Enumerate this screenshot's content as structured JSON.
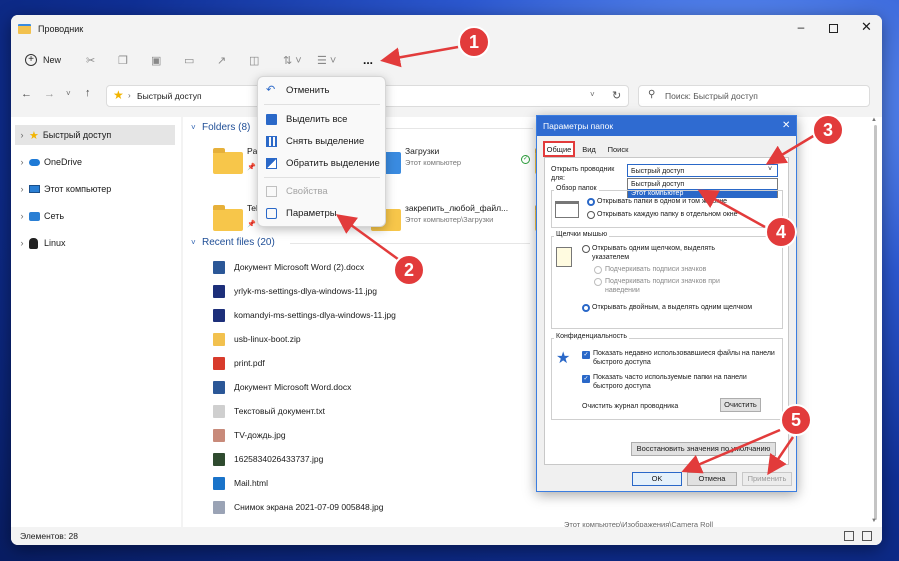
{
  "window": {
    "title": "Проводник"
  },
  "toolbar": {
    "new_label": "New",
    "more_label": "..."
  },
  "address": {
    "path": "Быстрый доступ",
    "search_placeholder": "Поиск: Быстрый доступ"
  },
  "sidebar": {
    "items": [
      {
        "label": "Быстрый доступ",
        "icon": "star-icon"
      },
      {
        "label": "OneDrive",
        "icon": "cloud-icon"
      },
      {
        "label": "Этот компьютер",
        "icon": "computer-icon"
      },
      {
        "label": "Сеть",
        "icon": "network-icon"
      },
      {
        "label": "Linux",
        "icon": "linux-icon"
      }
    ]
  },
  "main": {
    "folders_header": "Folders (8)",
    "folders": [
      {
        "name": "Pa",
        "sub": ""
      },
      {
        "name": "Загрузки",
        "sub": "Этот компьютер"
      },
      {
        "name": "Tel",
        "sub": ""
      },
      {
        "name": "закрепить_любой_файл...",
        "sub": "Этот компьютер\\Загрузки"
      }
    ],
    "recent_header": "Recent files (20)",
    "recent": [
      {
        "name": "Документ Microsoft Word (2).docx",
        "color": "#2b5797"
      },
      {
        "name": "yrlyk-ms-settings-dlya-windows-11.jpg",
        "color": "#1d2f7a"
      },
      {
        "name": "komandyi-ms-settings-dlya-windows-11.jpg",
        "color": "#1d2f7a"
      },
      {
        "name": "usb-linux-boot.zip",
        "color": "#f2c14e"
      },
      {
        "name": "print.pdf",
        "color": "#d83b2c"
      },
      {
        "name": "Документ Microsoft Word.docx",
        "color": "#2b5797"
      },
      {
        "name": "Текстовый документ.txt",
        "color": "#cfcfcf"
      },
      {
        "name": "TV-дождь.jpg",
        "color": "#c88a7a"
      },
      {
        "name": "1625834026433737.jpg",
        "color": "#2f4b2f"
      },
      {
        "name": "Mail.html",
        "color": "#1a73c9"
      },
      {
        "name": "Снимок экрана 2021-07-09 005848.jpg",
        "color": "#9aa3b5"
      }
    ],
    "last_location": "Этот компьютер\\Изображения\\Camera Roll"
  },
  "status": {
    "text": "Элементов: 28"
  },
  "menu": {
    "items": [
      {
        "label": "Отменить",
        "enabled": true
      },
      {
        "label": "Выделить все",
        "enabled": true
      },
      {
        "label": "Снять выделение",
        "enabled": true
      },
      {
        "label": "Обратить выделение",
        "enabled": true
      },
      {
        "label": "Свойства",
        "enabled": false
      },
      {
        "label": "Параметры",
        "enabled": true
      }
    ]
  },
  "dialog": {
    "title": "Параметры папок",
    "tabs": [
      "Общие",
      "Вид",
      "Поиск"
    ],
    "open_in_label": "Открыть проводник для:",
    "open_in_value": "Быстрый доступ",
    "open_in_options": [
      "Быстрый доступ",
      "Этот компьютер"
    ],
    "browse_group": "Обзор папок",
    "browse_opt1": "Открывать папки в одном и том же окне",
    "browse_opt2": "Открывать каждую папку в отдельном окне",
    "click_group": "Щелчки мышью",
    "click_opt1": "Открывать одним щелчком, выделять указателем",
    "click_sub1": "Подчеркивать подписи значков",
    "click_sub2": "Подчеркивать подписи значков при наведении",
    "click_opt2": "Открывать двойным, а выделять одним щелчком",
    "privacy_group": "Конфиденциальность",
    "privacy_chk1": "Показать недавно использовавшиеся файлы на панели быстрого доступа",
    "privacy_chk2": "Показать часто используемые папки на панели быстрого доступа",
    "clear_label": "Очистить журнал проводника",
    "clear_button": "Очистить",
    "restore_button": "Восстановить значения по умолчанию",
    "ok": "OK",
    "cancel": "Отмена",
    "apply": "Применить"
  },
  "annotations": [
    "1",
    "2",
    "3",
    "4",
    "5"
  ],
  "colors": {
    "accent": "#2f6bd1",
    "badge": "#e23b3b",
    "selected": "#e5e5e5"
  }
}
